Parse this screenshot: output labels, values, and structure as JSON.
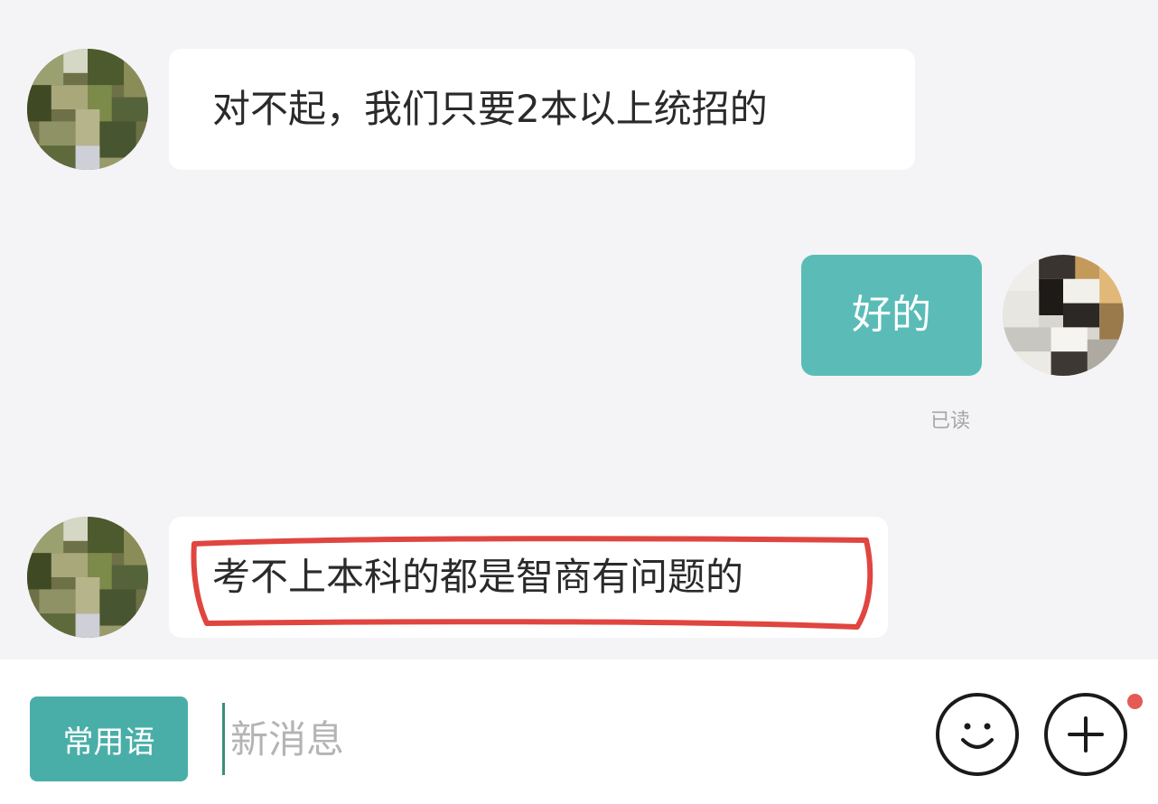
{
  "messages": [
    {
      "direction": "incoming",
      "text": "对不起，我们只要2本以上统招的",
      "avatar_icon": "tree-photo-avatar-icon"
    },
    {
      "direction": "outgoing",
      "text": "好的",
      "receipt": "已读",
      "avatar_icon": "cat-photo-avatar-icon"
    },
    {
      "direction": "incoming",
      "text": "考不上本科的都是智商有问题的",
      "highlighted": true,
      "highlight_color": "#e0453f",
      "avatar_icon": "tree-photo-avatar-icon"
    }
  ],
  "input_bar": {
    "quick_phrases_label": "常用语",
    "message_placeholder": "新消息",
    "emoji_icon": "smiley-face-icon",
    "plus_icon": "plus-circle-icon",
    "has_notification_dot": true
  },
  "colors": {
    "accent": "#5bbcb7",
    "quick_button": "#4aaea8",
    "highlight": "#e0453f",
    "notification": "#e45a55",
    "background": "#f4f4f6"
  }
}
